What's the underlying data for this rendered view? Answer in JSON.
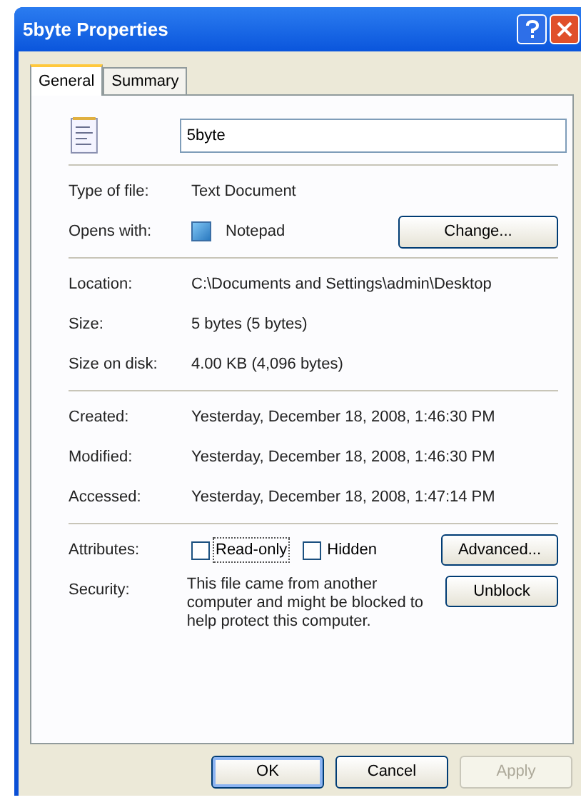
{
  "window": {
    "title": "5byte Properties"
  },
  "tabs": [
    {
      "label": "General",
      "selected": true
    },
    {
      "label": "Summary",
      "selected": false
    }
  ],
  "file_name": {
    "value": "5byte"
  },
  "type_section": [
    {
      "label": "Type of file:",
      "value": "Text Document"
    },
    {
      "label": "Opens with:",
      "value": "Notepad",
      "button": "Change..."
    }
  ],
  "location_section": [
    {
      "label": "Location:",
      "value": "C:\\Documents and Settings\\admin\\Desktop"
    },
    {
      "label": "Size:",
      "value": "5 bytes (5 bytes)"
    },
    {
      "label": "Size on disk:",
      "value": "4.00 KB (4,096 bytes)"
    }
  ],
  "dates_section": [
    {
      "label": "Created:",
      "value": "Yesterday, December 18, 2008, 1:46:30 PM"
    },
    {
      "label": "Modified:",
      "value": "Yesterday, December 18, 2008, 1:46:30 PM"
    },
    {
      "label": "Accessed:",
      "value": "Yesterday, December 18, 2008, 1:47:14 PM"
    }
  ],
  "attributes": {
    "label": "Attributes:",
    "checkboxes": [
      {
        "label": "Read-only",
        "checked": false,
        "focused": true
      },
      {
        "label": "Hidden",
        "checked": false,
        "focused": false
      }
    ],
    "button": "Advanced..."
  },
  "security": {
    "label": "Security:",
    "text": "This file came from another computer and might be blocked to help protect this computer.",
    "button": "Unblock"
  },
  "buttons": [
    {
      "label": "OK",
      "disabled": false,
      "default": true
    },
    {
      "label": "Cancel",
      "disabled": false,
      "default": false
    },
    {
      "label": "Apply",
      "disabled": true,
      "default": false
    }
  ]
}
